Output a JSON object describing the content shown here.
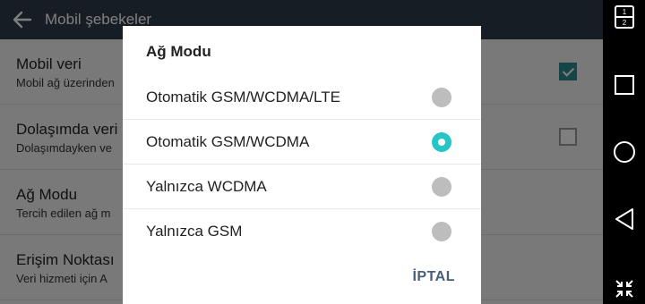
{
  "appbar": {
    "title": "Mobil şebekeler"
  },
  "settings": [
    {
      "title": "Mobil veri",
      "subtitle": "Mobil ağ üzerinden",
      "checked": true
    },
    {
      "title": "Dolaşımda veri",
      "subtitle": "Dolaşımdayken ve",
      "checked": false
    },
    {
      "title": "Ağ Modu",
      "subtitle": "Tercih edilen ağ m"
    },
    {
      "title": "Erişim Noktası",
      "subtitle": "Veri hizmeti için A"
    }
  ],
  "dialog": {
    "title": "Ağ Modu",
    "options": [
      {
        "label": "Otomatik GSM/WCDMA/LTE",
        "selected": false
      },
      {
        "label": "Otomatik GSM/WCDMA",
        "selected": true
      },
      {
        "label": "Yalnızca WCDMA",
        "selected": false
      },
      {
        "label": "Yalnızca GSM",
        "selected": false
      }
    ],
    "cancel_label": "İPTAL"
  },
  "navbar": {
    "buttons": [
      "dual-window-icon",
      "recent-apps-icon",
      "home-icon",
      "back-icon",
      "minimize-icon"
    ]
  },
  "colors": {
    "accent": "#26c6c6",
    "appbar": "#2f3a4a",
    "checkbox": "#2c8a8e"
  }
}
